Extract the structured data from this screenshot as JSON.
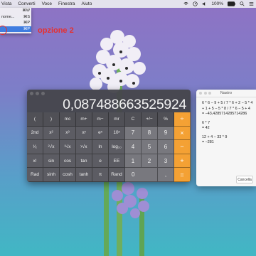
{
  "menubar": {
    "items": [
      "Vista",
      "Converti",
      "Voce",
      "Finestra",
      "Aiuto"
    ],
    "status": {
      "percent": "100%"
    }
  },
  "dropdown": {
    "rows": [
      {
        "label": "",
        "shortcut": "⌘W"
      },
      {
        "label": "nome...",
        "shortcut": "⌘S"
      },
      {
        "label": "",
        "shortcut": "⌘P"
      },
      {
        "label": "",
        "shortcut": "⌘P"
      }
    ]
  },
  "annotation": "opzione 2",
  "calculator": {
    "display": "0,087488663525924",
    "keys": [
      [
        "(",
        ")",
        "mc",
        "m+",
        "m−",
        "mr",
        "C",
        "+/−",
        "%",
        "÷"
      ],
      [
        "2nd",
        "x²",
        "x³",
        "xʸ",
        "eˣ",
        "10ˣ",
        "7",
        "8",
        "9",
        "×"
      ],
      [
        "¹⁄ₓ",
        "²√x",
        "³√x",
        "ʸ√x",
        "ln",
        "log₁₀",
        "4",
        "5",
        "6",
        "−"
      ],
      [
        "x!",
        "sin",
        "cos",
        "tan",
        "e",
        "EE",
        "1",
        "2",
        "3",
        "+"
      ],
      [
        "Rad",
        "sinh",
        "cosh",
        "tanh",
        "π",
        "Rand",
        "0",
        "",
        ",",
        "="
      ]
    ]
  },
  "tape": {
    "title": "Nastro",
    "lines": [
      "6 * 6 − 9 + 5 / 7 * 6 + 2 − 5 * 4",
      "+ 1 + 5 − 5 * 8 / 7 * 6 − 5 + 4",
      "= −43,4285714285714286",
      "",
      "6 * 7",
      "= 42",
      "",
      "12 + 4 − 33 * 9",
      "= −281"
    ],
    "clear_label": "Cancella"
  }
}
